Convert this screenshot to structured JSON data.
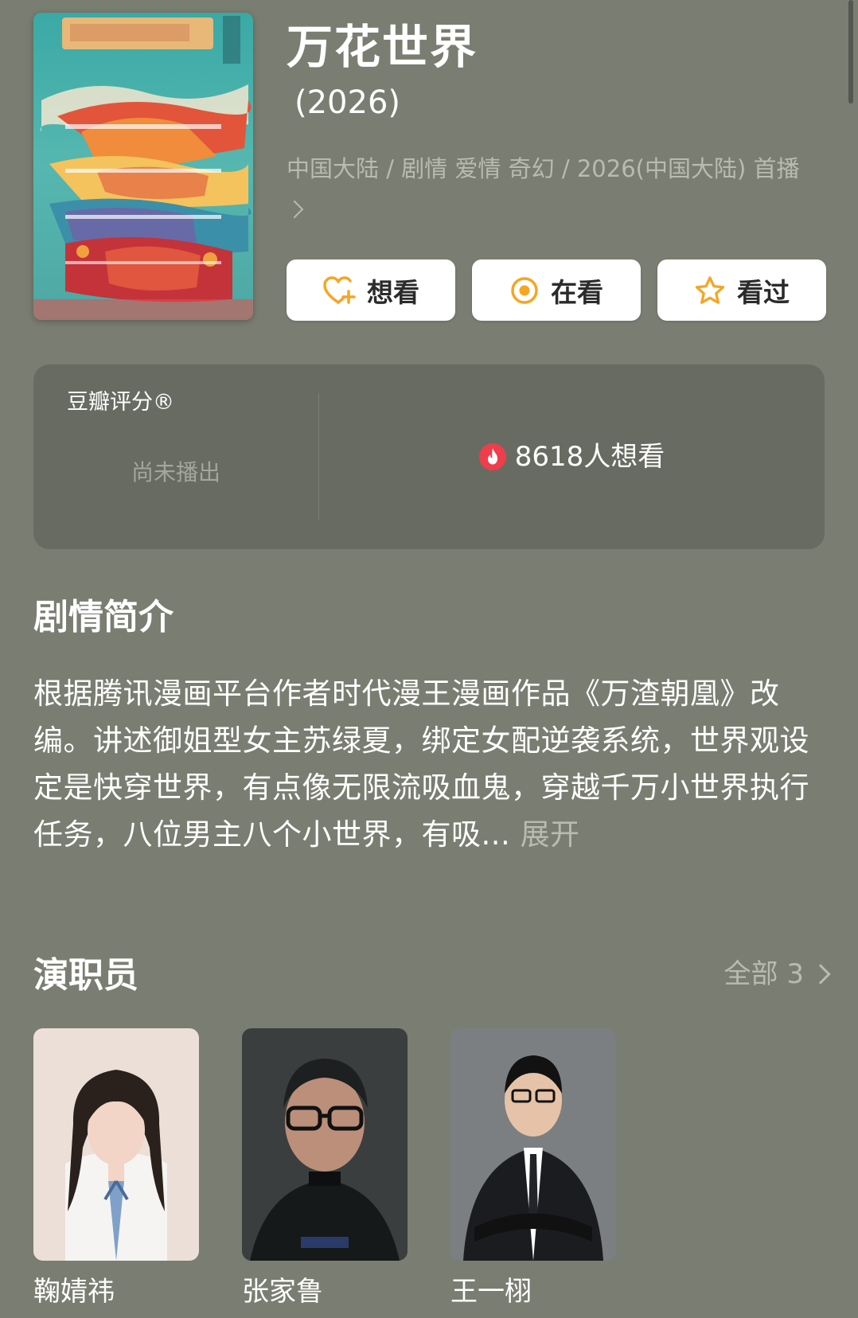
{
  "show": {
    "title": "万花世界",
    "year": "(2026)",
    "meta": "中国大陆 / 剧情 爱情 奇幻 / 2026(中国大陆) 首播"
  },
  "actions": {
    "want": "想看",
    "watching": "在看",
    "watched": "看过"
  },
  "rating": {
    "label": "豆瓣评分®",
    "status": "尚未播出",
    "wish_count": "8618人想看"
  },
  "synopsis": {
    "heading": "剧情简介",
    "text": "根据腾讯漫画平台作者时代漫王漫画作品《万渣朝凰》改编。讲述御姐型女主苏绿夏，绑定女配逆袭系统，世界观设定是快穿世界，有点像无限流吸血鬼，穿越千万小世界执行任务，八位男主八个小世界，有吸...",
    "expand": "展开"
  },
  "cast": {
    "heading": "演职员",
    "all_label": "全部 3",
    "members": [
      {
        "name": "鞠婧祎"
      },
      {
        "name": "张家鲁"
      },
      {
        "name": "王一栩"
      }
    ]
  },
  "colors": {
    "background": "#7a7d71",
    "card": "#686b61",
    "accent": "#f5a623",
    "fire": "#ee3e4d"
  }
}
